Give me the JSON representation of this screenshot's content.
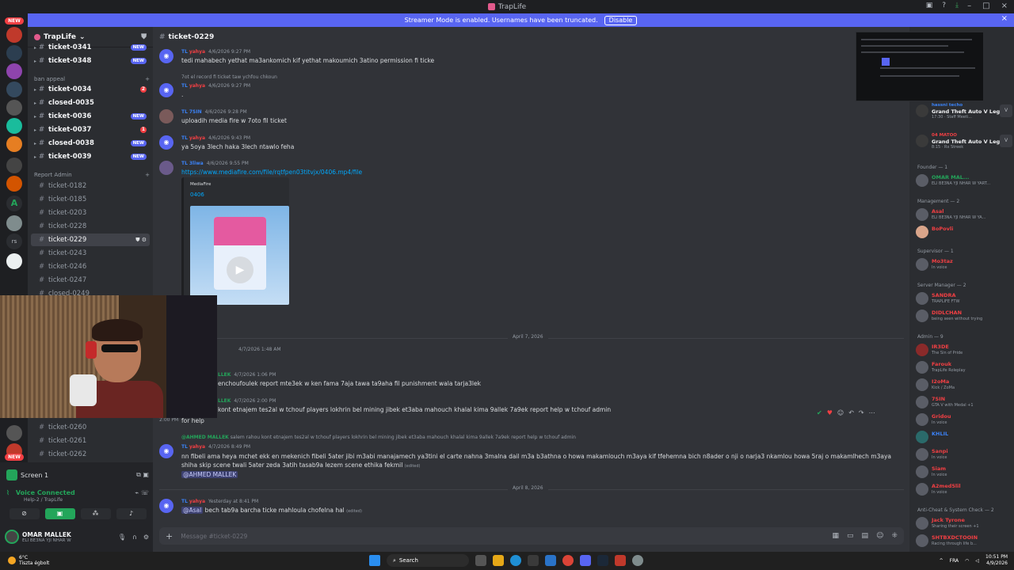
{
  "window": {
    "title": "TrapLife"
  },
  "streamer_bar": {
    "message": "Streamer Mode is enabled. Usernames have been truncated.",
    "disable_label": "Disable"
  },
  "server": {
    "name": "TrapLife"
  },
  "guild_badges": [
    "NEW",
    "NEW"
  ],
  "channels": {
    "top": [
      {
        "name": "ticket-0341",
        "badge": "NEW"
      },
      {
        "name": "ticket-0348",
        "badge": "NEW"
      }
    ],
    "cat_ban_appeal": "ban appeal",
    "ban_appeal": [
      {
        "name": "ticket-0034",
        "badge": "2"
      },
      {
        "name": "closed-0035",
        "badge": ""
      },
      {
        "name": "ticket-0036",
        "badge": "NEW"
      },
      {
        "name": "ticket-0037",
        "badge": "1"
      },
      {
        "name": "closed-0038",
        "badge": "NEW"
      },
      {
        "name": "ticket-0039",
        "badge": "NEW"
      }
    ],
    "cat_report_admin": "Report Admin",
    "report_admin": [
      "ticket-0182",
      "ticket-0185",
      "ticket-0203",
      "ticket-0228",
      "ticket-0229",
      "ticket-0243",
      "ticket-0246",
      "ticket-0247",
      "closed-0249"
    ],
    "bottom": [
      "ticket-0260",
      "ticket-0261",
      "ticket-0262"
    ]
  },
  "user_panel": {
    "screen_label": "Screen 1",
    "voice_label": "Voice Connected",
    "voice_sub": "Help-2 / TrapLife",
    "me_name": "OMAR MALLEK",
    "me_sub": "ELI BE3NA YJI NHAR W"
  },
  "chat": {
    "channel": "ticket-0229",
    "messages": [
      {
        "tag": "TL",
        "name": "yahya",
        "time": "4/6/2026 9:27 PM",
        "text": "tedi mahabech yethat ma3ankomich kif yethat makoumich 3atino permission fi ticke"
      },
      {
        "reply": "7ot el record fi ticket taw ychfou chkoun",
        "tag": "TL",
        "name": "yahya",
        "time": "4/6/2026 9:27 PM",
        "text": "."
      },
      {
        "tag": "TL",
        "name": "7SIN",
        "time": "4/6/2026 9:28 PM",
        "text": "uploadih media fire w 7oto fil ticket"
      },
      {
        "tag": "TL",
        "name": "yahya",
        "time": "4/6/2026 9:43 PM",
        "text": "ya 5oya 3lech haka 3lech ntawlo feha"
      },
      {
        "tag": "TL",
        "name": "3liwa",
        "time": "4/6/2026 9:55 PM",
        "text": "https://www.mediafire.com/file/rqtfpen03titvjx/0406.mp4/file"
      }
    ],
    "embed": {
      "provider": "MediaFire",
      "title": "0406"
    },
    "date_1": "April 7, 2026",
    "messages_2": [
      {
        "time": "4/7/2026 1:48 AM",
        "text": ""
      },
      {
        "name": "LLEK",
        "time": "4/7/2026 1:06 PM",
        "text": "enchoufoulek report mte3ek w ken fama 7aja tawa ta9aha fil punishment wala tarja3lek"
      },
      {
        "name": "LLEK",
        "time": "4/7/2026 2:00 PM",
        "text": "kont etnajem tes2al w tchouf players lokhrin bel mining jibek et3aba mahouch khalal kima 9allek 7a9ek report help w tchouf admin"
      },
      {
        "time": "2:00 PM",
        "text": "for help"
      }
    ],
    "reply_2": {
      "name": "@AHMED MALLEK",
      "text": "salem rahou kont etnajem tes2al w tchouf players lokhrin bel mining jibek et3aba mahouch khalal kima 9allek 7a9ek report help w tchouf admin"
    },
    "msg_long": {
      "tag": "TL",
      "name": "yahya",
      "time": "4/7/2026 8:49 PM",
      "text": "nn fibeli ama heya mchet ekk en mekenich fibeli 5ater jibi m3abi manajamech ya3tini el carte nahna 3malna dail m3a b3athna o howa makamlouch m3aya kif tfehemna bich n8ader o nji o narja3 nkamlou howa 5raj o makamlhech m3aya shiha skip scene twali 5ater zeda 3atih tasab9a lezem scene ethika fekmil",
      "edited": "(edited)",
      "mention": "@AHMED MALLEK"
    },
    "date_2": "April 8, 2026",
    "msg_last": {
      "tag": "TL",
      "name": "yahya",
      "time": "Yesterday at 8:41 PM",
      "mention": "@Asal",
      "text": "bech tab9a barcha ticke mahloula chofelna hal",
      "edited": "(edited)"
    },
    "composer_placeholder": "Message #ticket-0229"
  },
  "members": {
    "games": [
      {
        "name": "hassni techo",
        "game": "Grand Theft Auto V Legacy",
        "sub": "17:30 · Staff Meeti..."
      },
      {
        "name": "04 MATOO",
        "game": "Grand Theft Auto V Legacy",
        "sub": "8:15 · Rx Streek"
      }
    ],
    "groups": [
      {
        "title": "Founder — 1",
        "members": [
          {
            "name": "OMAR MAL...",
            "sub": "ELI BE3NA YJI NHAR W YART...",
            "color": "#23a55a"
          }
        ]
      },
      {
        "title": "Management — 2",
        "members": [
          {
            "name": "Asal",
            "sub": "ELI BE3NA YJI NHAR W YA...",
            "color": "#f23f43"
          },
          {
            "name": "BoPovli",
            "sub": "",
            "color": "#f23f43"
          }
        ]
      },
      {
        "title": "Supervisor — 1",
        "members": [
          {
            "name": "Mo3taz",
            "sub": "In voice",
            "color": "#f23f43"
          }
        ]
      },
      {
        "title": "Server Manager — 2",
        "members": [
          {
            "name": "SANDRA",
            "sub": "TRAPLIFE FTW",
            "color": "#f23f43"
          },
          {
            "name": "DIDLCHAN",
            "sub": "being seen without trying",
            "color": "#f23f43"
          }
        ]
      },
      {
        "title": "Admin — 9",
        "members": [
          {
            "name": "IR3DE",
            "sub": "The Sin of Pride",
            "color": "#f23f43"
          },
          {
            "name": "Farouk",
            "sub": "TrapLife Roleplay",
            "color": "#f23f43"
          },
          {
            "name": "I2oMa",
            "sub": "Kick / ZoMa",
            "color": "#f23f43"
          },
          {
            "name": "7SIN",
            "sub": "GTA V with Medal +1",
            "color": "#f23f43"
          },
          {
            "name": "Gridou",
            "sub": "In voice",
            "color": "#f23f43"
          },
          {
            "name": "KHLIL",
            "sub": "",
            "color": "#3b82f6"
          },
          {
            "name": "Sanpi",
            "sub": "In voice",
            "color": "#f23f43"
          },
          {
            "name": "Siam",
            "sub": "In voice",
            "color": "#f23f43"
          },
          {
            "name": "A2med5lil",
            "sub": "In voice",
            "color": "#f23f43"
          }
        ]
      },
      {
        "title": "Anti-Cheat & System Check — 2",
        "members": [
          {
            "name": "Jack Tyrone",
            "sub": "Sharing their screen +1",
            "color": "#f23f43"
          },
          {
            "name": "SHTBXDCTOOIN",
            "sub": "Racing through life b...",
            "color": "#f23f43"
          }
        ]
      }
    ]
  },
  "taskbar": {
    "temp": "6°C",
    "weather": "Tiszta égbolt",
    "search": "Search",
    "lang": "FRA",
    "time": "10:51 PM",
    "date": "4/9/2026"
  }
}
